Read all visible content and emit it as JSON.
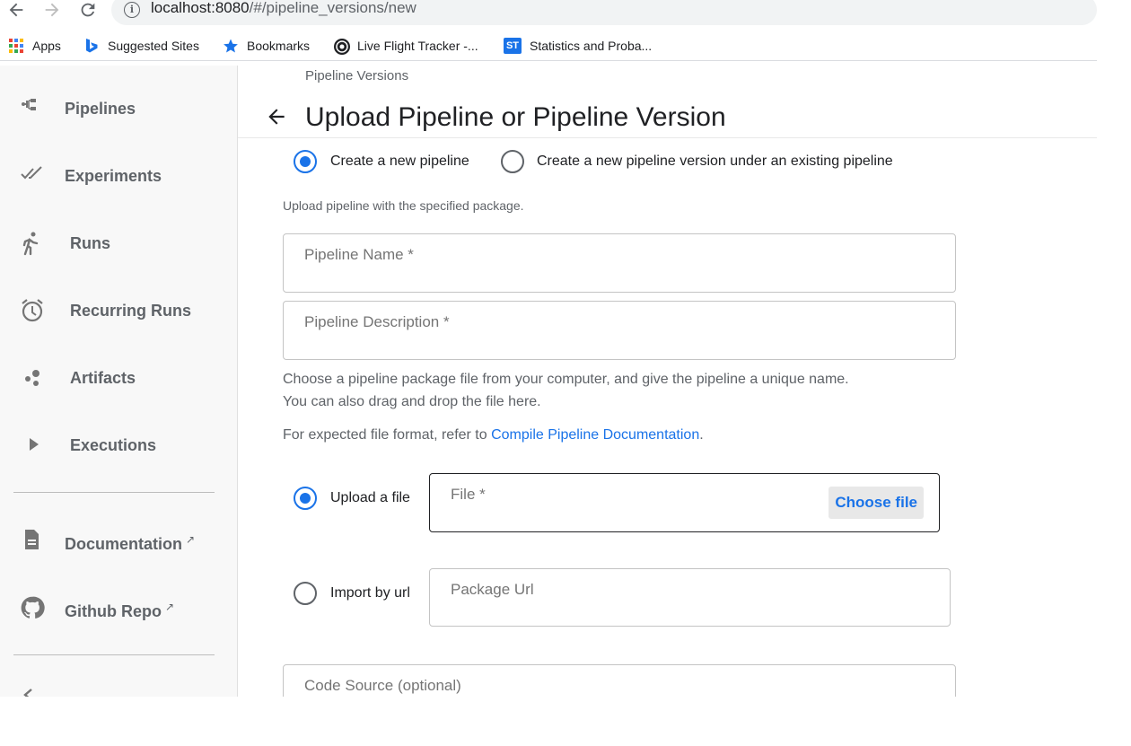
{
  "browser": {
    "url_host": "localhost:8080",
    "url_path": "/#/pipeline_versions/new"
  },
  "bookmarks": [
    {
      "label": "Apps",
      "icon": "apps-grid-icon"
    },
    {
      "label": "Suggested Sites",
      "icon": "bing-icon"
    },
    {
      "label": "Bookmarks",
      "icon": "star-icon"
    },
    {
      "label": "Live Flight Tracker -...",
      "icon": "flight-tracker-icon"
    },
    {
      "label": "Statistics and Proba...",
      "icon": "st-icon"
    }
  ],
  "sidebar": {
    "items": [
      {
        "label": "Pipelines",
        "icon": "pipelines-icon"
      },
      {
        "label": "Experiments",
        "icon": "experiments-icon"
      },
      {
        "label": "Runs",
        "icon": "runs-icon"
      },
      {
        "label": "Recurring Runs",
        "icon": "alarm-icon"
      },
      {
        "label": "Artifacts",
        "icon": "artifacts-icon"
      },
      {
        "label": "Executions",
        "icon": "play-icon"
      }
    ],
    "links": [
      {
        "label": "Documentation",
        "icon": "document-icon"
      },
      {
        "label": "Github Repo",
        "icon": "github-icon"
      }
    ]
  },
  "main": {
    "breadcrumb": "Pipeline Versions",
    "title": "Upload Pipeline or Pipeline Version",
    "mode_options": [
      "Create a new pipeline",
      "Create a new pipeline version under an existing pipeline"
    ],
    "mode_selected": 0,
    "upload_hint": "Upload pipeline with the specified package.",
    "pipeline_name_placeholder": "Pipeline Name *",
    "pipeline_description_placeholder": "Pipeline Description *",
    "choose_text_1": "Choose a pipeline package file from your computer, and give the pipeline a unique name.",
    "choose_text_2": "You can also drag and drop the file here.",
    "format_text": "For expected file format, refer to ",
    "format_link": "Compile Pipeline Documentation",
    "format_suffix": ".",
    "source_options": [
      "Upload a file",
      "Import by url"
    ],
    "source_selected": 0,
    "file_placeholder": "File *",
    "choose_file_label": "Choose file",
    "package_url_placeholder": "Package Url",
    "code_source_placeholder": "Code Source (optional)"
  },
  "colors": {
    "accent": "#1a73e8",
    "sidebar_bg": "#f8f8f8",
    "text_muted": "#5f6368"
  }
}
